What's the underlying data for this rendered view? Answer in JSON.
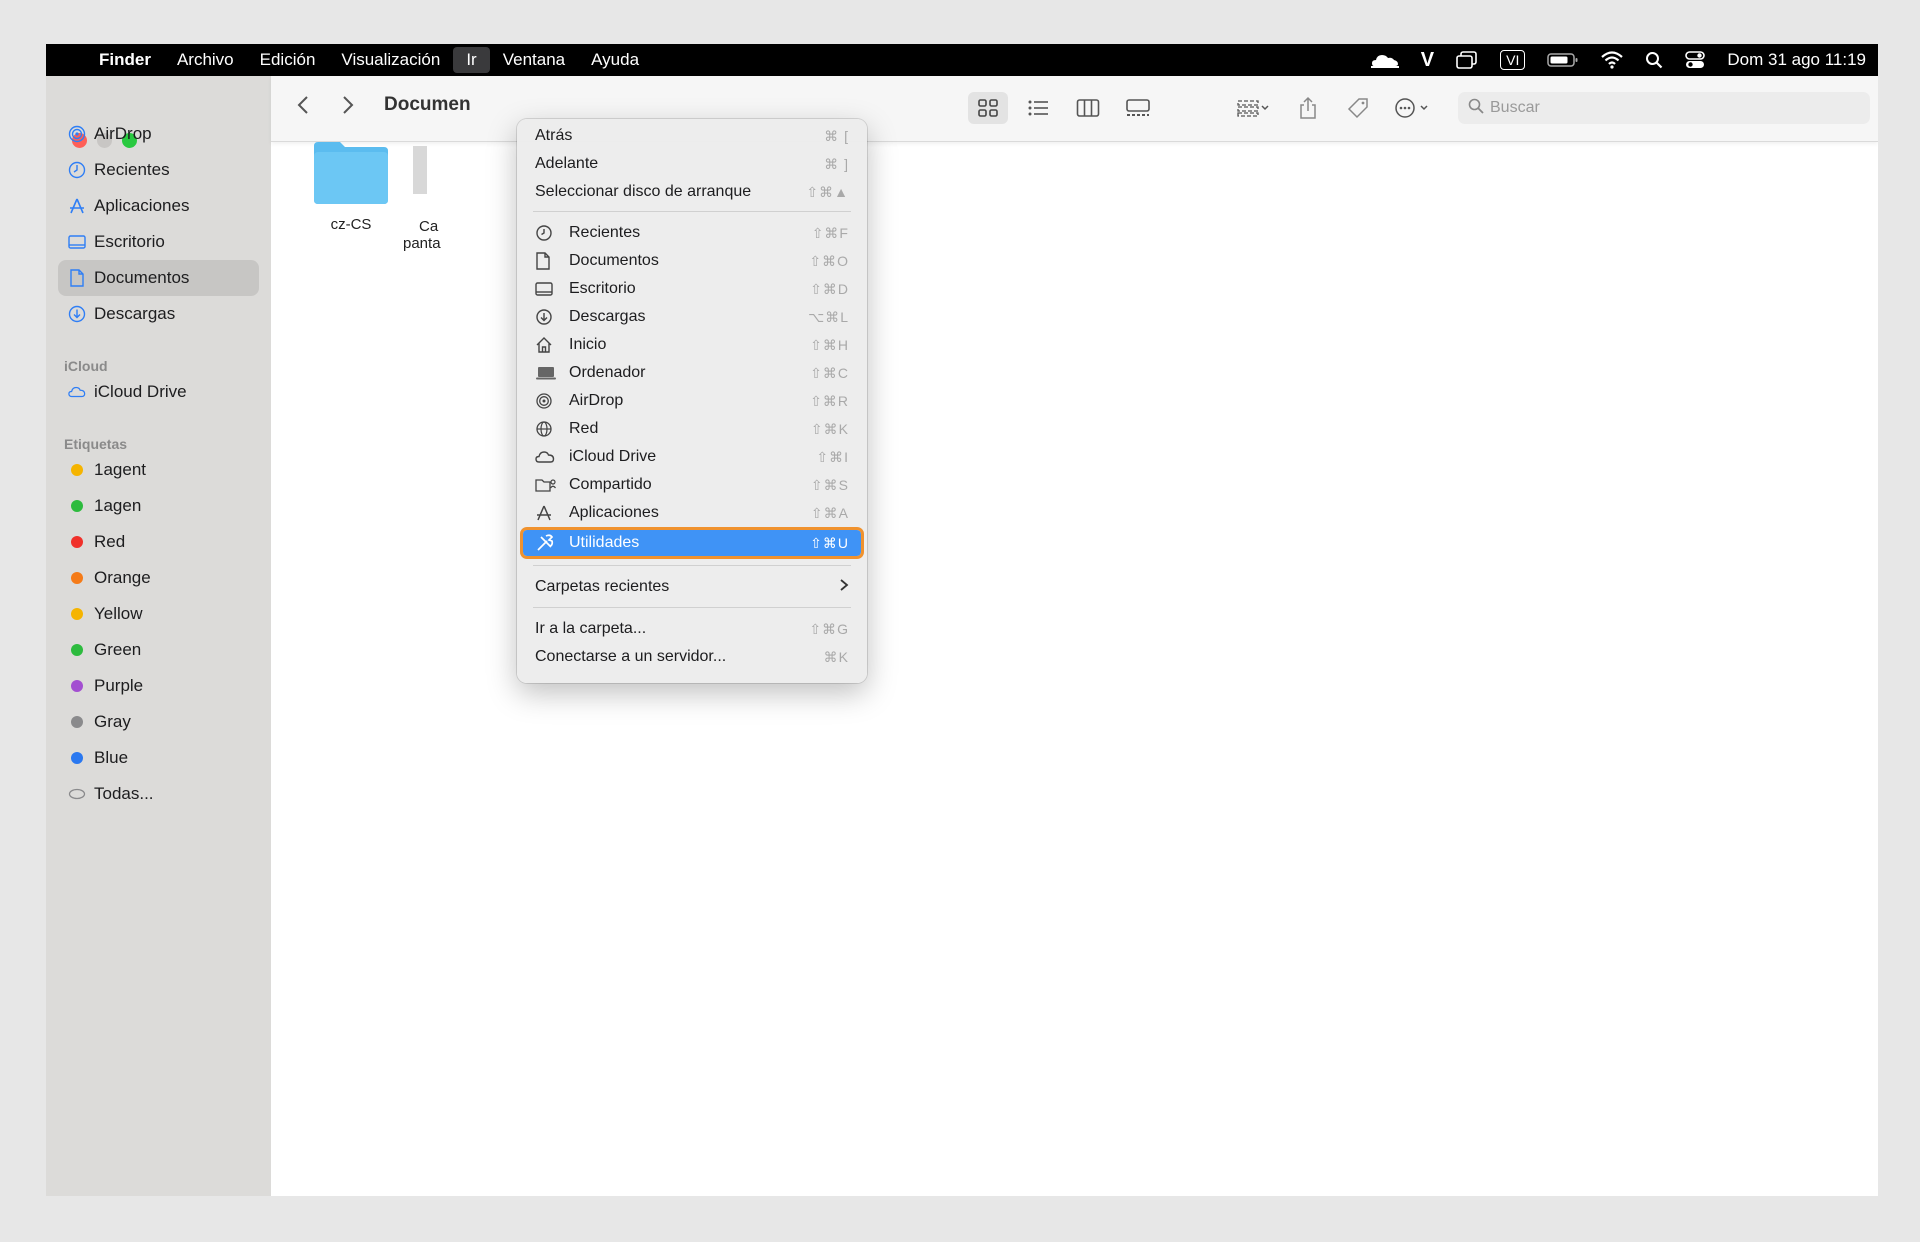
{
  "menubar": {
    "apple": "",
    "items": [
      "Finder",
      "Archivo",
      "Edición",
      "Visualización",
      "Ir",
      "Ventana",
      "Ayuda"
    ],
    "clock": "Dom 31 ago 11:19",
    "status_icons": [
      "cloud-icon",
      "v-icon",
      "window-icon",
      "input-source-icon",
      "battery-icon",
      "wifi-icon",
      "spotlight-icon",
      "control-center-icon"
    ],
    "input_source": "VI"
  },
  "window": {
    "title": "Documen",
    "search_placeholder": "Buscar"
  },
  "sidebar": {
    "favorites": [
      {
        "label": "AirDrop",
        "icon": "airdrop-icon"
      },
      {
        "label": "Recientes",
        "icon": "clock-icon"
      },
      {
        "label": "Aplicaciones",
        "icon": "apps-icon"
      },
      {
        "label": "Escritorio",
        "icon": "desktop-icon"
      },
      {
        "label": "Documentos",
        "icon": "document-icon",
        "selected": true
      },
      {
        "label": "Descargas",
        "icon": "download-icon"
      }
    ],
    "icloud_heading": "iCloud",
    "icloud": [
      {
        "label": "iCloud Drive",
        "icon": "cloud-icon"
      }
    ],
    "tags_heading": "Etiquetas",
    "tags": [
      {
        "label": "1agent",
        "color": "#f5b400"
      },
      {
        "label": "1agen",
        "color": "#2dbb3e"
      },
      {
        "label": "Red",
        "color": "#f0302a"
      },
      {
        "label": "Orange",
        "color": "#f57b18"
      },
      {
        "label": "Yellow",
        "color": "#f5b400"
      },
      {
        "label": "Green",
        "color": "#2dbb3e"
      },
      {
        "label": "Purple",
        "color": "#a34fd1"
      },
      {
        "label": "Gray",
        "color": "#8a8a8c"
      },
      {
        "label": "Blue",
        "color": "#2a78f0"
      }
    ],
    "all_tags": "Todas..."
  },
  "files": [
    {
      "name": "cz-CS"
    },
    {
      "name_line1": "Ca",
      "name_line2": "panta"
    }
  ],
  "go_menu": {
    "top": [
      {
        "label": "Atrás",
        "shortcut": "⌘ ["
      },
      {
        "label": "Adelante",
        "shortcut": "⌘ ]"
      },
      {
        "label": "Seleccionar disco de arranque",
        "shortcut": "⇧⌘▲"
      }
    ],
    "places": [
      {
        "label": "Recientes",
        "shortcut": "⇧⌘F",
        "icon": "clock-icon"
      },
      {
        "label": "Documentos",
        "shortcut": "⇧⌘O",
        "icon": "document-icon"
      },
      {
        "label": "Escritorio",
        "shortcut": "⇧⌘D",
        "icon": "desktop-icon"
      },
      {
        "label": "Descargas",
        "shortcut": "⌥⌘L",
        "icon": "download-icon"
      },
      {
        "label": "Inicio",
        "shortcut": "⇧⌘H",
        "icon": "home-icon"
      },
      {
        "label": "Ordenador",
        "shortcut": "⇧⌘C",
        "icon": "computer-icon"
      },
      {
        "label": "AirDrop",
        "shortcut": "⇧⌘R",
        "icon": "airdrop-icon"
      },
      {
        "label": "Red",
        "shortcut": "⇧⌘K",
        "icon": "network-icon"
      },
      {
        "label": "iCloud Drive",
        "shortcut": "⇧⌘I",
        "icon": "cloud-icon"
      },
      {
        "label": "Compartido",
        "shortcut": "⇧⌘S",
        "icon": "shared-folder-icon"
      },
      {
        "label": "Aplicaciones",
        "shortcut": "⇧⌘A",
        "icon": "apps-icon"
      },
      {
        "label": "Utilidades",
        "shortcut": "⇧⌘U",
        "icon": "utilities-icon",
        "highlighted": true
      }
    ],
    "recent_folders": "Carpetas recientes",
    "bottom": [
      {
        "label": "Ir a la carpeta...",
        "shortcut": "⇧⌘G"
      },
      {
        "label": "Conectarse a un servidor...",
        "shortcut": "⌘K"
      }
    ]
  }
}
